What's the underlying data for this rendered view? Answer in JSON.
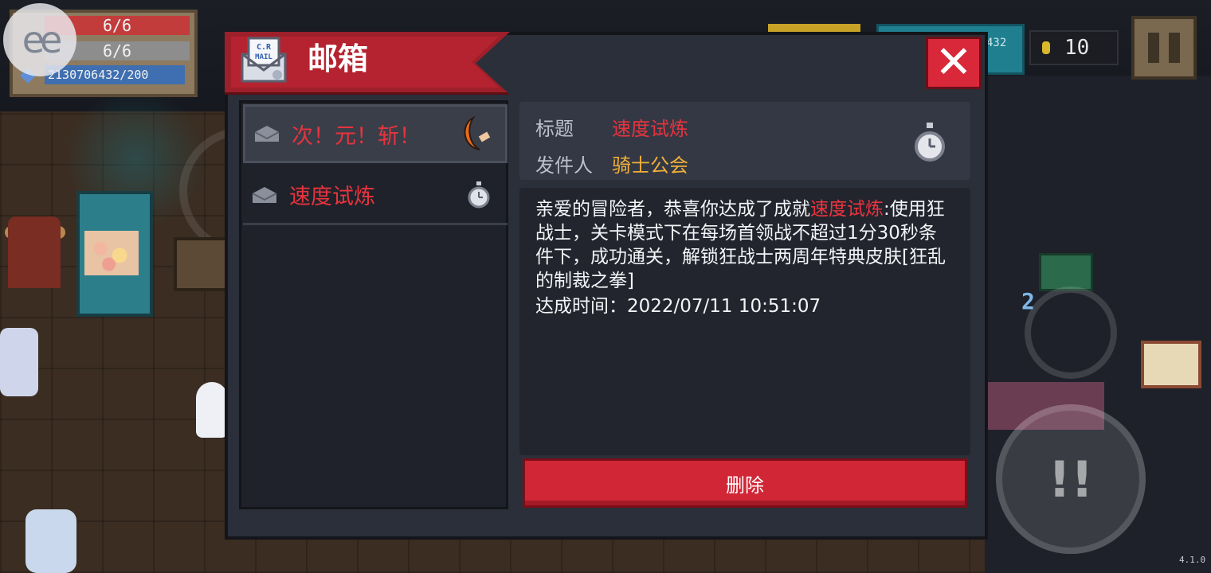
{
  "hud": {
    "hp": "6/6",
    "armor": "6/6",
    "energy": "2130706432/200",
    "coins": "10",
    "top_counter_fragment": "432"
  },
  "overlay_logo": "ee",
  "mailbox": {
    "title": "邮箱",
    "mail_icon_text": "C.R MAIL",
    "mails": [
      {
        "label": "次！元！斩！",
        "icon": "crescent-blade-icon",
        "selected": true
      },
      {
        "label": "速度试炼",
        "icon": "stopwatch-icon",
        "selected": false
      }
    ],
    "detail": {
      "title_label": "标题",
      "title_value": "速度试炼",
      "sender_label": "发件人",
      "sender_value": "骑士公会",
      "body_prefix": "亲爱的冒险者，恭喜你达成了成就",
      "body_highlight": "速度试炼",
      "body_suffix": ":使用狂战士，关卡模式下在每场首领战不超过1分30秒条件下，成功通关，解锁狂战士两周年特典皮肤[狂乱的制裁之拳]",
      "time_line": "达成时间：2022/07/11 10:51:07"
    },
    "delete_label": "删除"
  },
  "version": "4.1.0",
  "colors": {
    "accent_red": "#e8333e",
    "sender_gold": "#f0b03a",
    "ribbon_red": "#b4232f"
  }
}
